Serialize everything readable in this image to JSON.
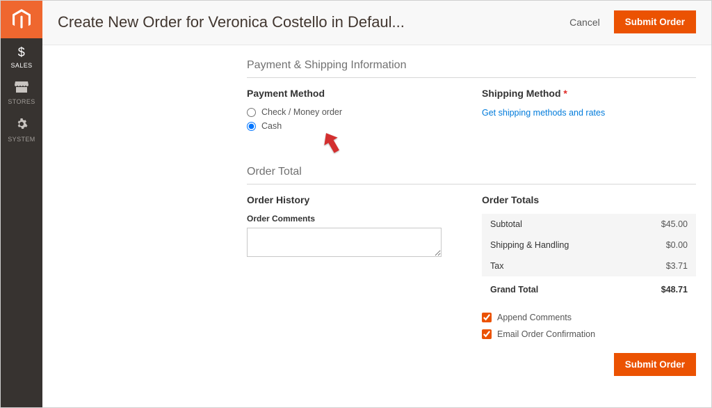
{
  "sidebar": {
    "items": [
      {
        "label": "SALES",
        "icon": "$"
      },
      {
        "label": "STORES",
        "icon": "stores"
      },
      {
        "label": "SYSTEM",
        "icon": "gear"
      }
    ]
  },
  "header": {
    "title": "Create New Order for Veronica Costello in Defaul...",
    "cancel_label": "Cancel",
    "submit_label": "Submit Order"
  },
  "payment": {
    "section_title": "Payment & Shipping Information",
    "method_title": "Payment Method",
    "options": [
      {
        "label": "Check / Money order"
      },
      {
        "label": "Cash"
      }
    ]
  },
  "shipping": {
    "title": "Shipping Method",
    "link_label": "Get shipping methods and rates"
  },
  "order_total": {
    "section_title": "Order Total",
    "history_title": "Order History",
    "comments_label": "Order Comments",
    "totals_title": "Order Totals",
    "rows": [
      {
        "label": "Subtotal",
        "value": "$45.00"
      },
      {
        "label": "Shipping & Handling",
        "value": "$0.00"
      },
      {
        "label": "Tax",
        "value": "$3.71"
      }
    ],
    "grand_label": "Grand Total",
    "grand_value": "$48.71",
    "append_label": "Append Comments",
    "email_label": "Email Order Confirmation",
    "submit_label": "Submit Order"
  }
}
